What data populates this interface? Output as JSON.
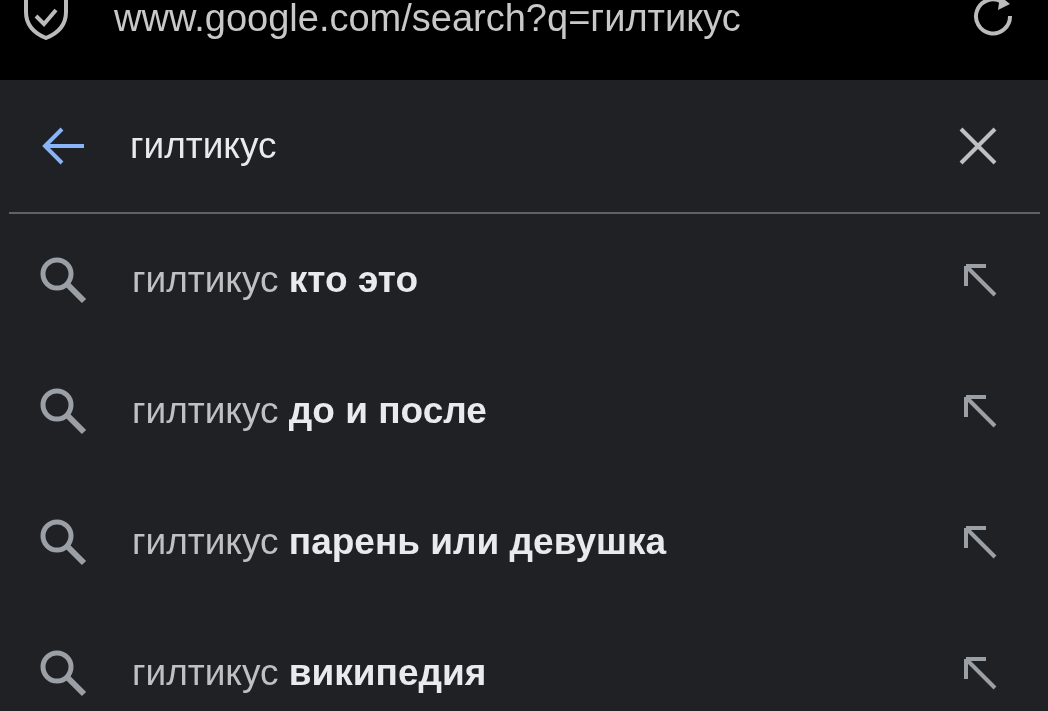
{
  "address_bar": {
    "url": "www.google.com/search?q=гилтикус"
  },
  "search": {
    "value": "гилтикус"
  },
  "suggestions": [
    {
      "text": "гилтикус **кто это**"
    },
    {
      "text": "гилтикус **до и после**"
    },
    {
      "text": "гилтикус **парень или девушка**"
    },
    {
      "text": "гилтикус **википедия**"
    }
  ]
}
